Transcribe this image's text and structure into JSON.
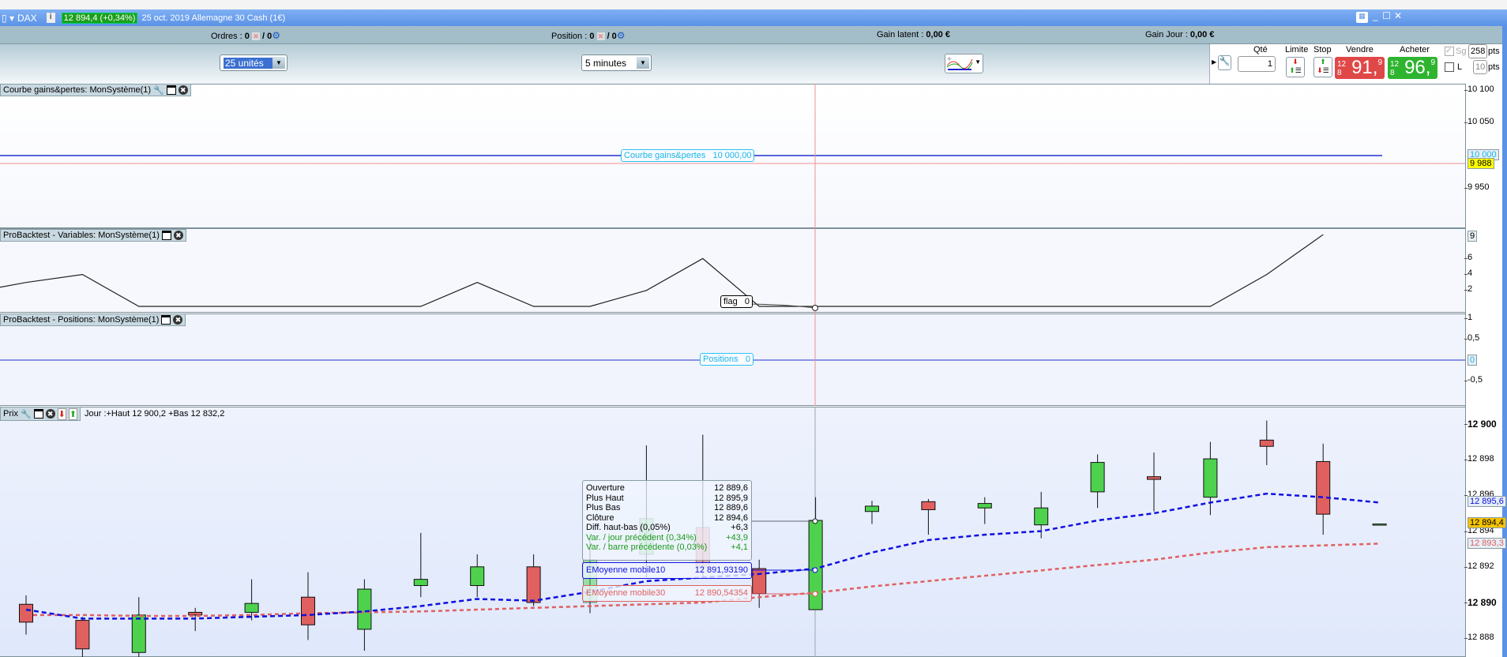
{
  "titlebar": {
    "symbol": "DAX",
    "price_badge": "12 894,4 (+0,34%)",
    "description": "25 oct. 2019 Allemagne 30 Cash (1€)",
    "info_icon": "info-icon",
    "window_icons": [
      "keyboard-icon",
      "minimize-icon",
      "maximize-icon",
      "close-icon"
    ]
  },
  "status": {
    "orders_label": "Ordres :",
    "orders_val": "0",
    "orders_total": "/ 0",
    "position_label": "Position :",
    "position_val": "0",
    "position_total": "/ 0",
    "gain_latent_label": "Gain latent :",
    "gain_latent_val": "0,00 €",
    "gain_jour_label": "Gain Jour :",
    "gain_jour_val": "0,00 €"
  },
  "toolbar": {
    "units": "25 unités",
    "timeframe": "5 minutes"
  },
  "trading": {
    "qty_label": "Qté",
    "qty": "1",
    "limit_label": "Limite",
    "stop_label": "Stop",
    "sell_label": "Vendre",
    "sell_small": "12 8",
    "sell_big": "91,",
    "sell_sup": "9",
    "buy_label": "Acheter",
    "buy_small": "12 8",
    "buy_big": "96,",
    "buy_sup": "9",
    "sg_label": "Sg",
    "sg_pts": "258",
    "l_label": "L",
    "l_pts": "10",
    "pts": "pts",
    "colors": {
      "sell": "#e04848",
      "buy": "#2fb42f"
    }
  },
  "panel_equity": {
    "title": "Courbe gains&pertes: MonSystème(1)",
    "label": "Courbe gains&pertes",
    "value": "10 000,00",
    "ticks": [
      "10 100",
      "10 050",
      "9 950"
    ],
    "current": "10 000",
    "marker": "9 988"
  },
  "panel_vars": {
    "title": "ProBacktest - Variables: MonSystème(1)",
    "label": "flag",
    "value": "0",
    "ticks": [
      "6",
      "4",
      "2"
    ],
    "current": "9",
    "series": [
      2.4,
      3,
      4,
      0,
      0,
      0,
      0,
      0,
      0,
      3,
      0,
      0,
      2,
      6,
      0,
      0,
      0,
      0,
      0,
      0,
      0,
      0,
      0,
      4,
      9
    ]
  },
  "panel_pos": {
    "title": "ProBacktest - Positions: MonSystème(1)",
    "label": "Positions",
    "value": "0",
    "ticks": [
      "1",
      "0,5",
      "-0,5"
    ],
    "current": "0"
  },
  "panel_price": {
    "title": "Prix",
    "day_info": "Jour :+Haut 12 900,2 +Bas 12 832,2",
    "ticks": [
      {
        "v": 12900,
        "t": "12 900",
        "bold": true
      },
      {
        "v": 12898,
        "t": "12 898"
      },
      {
        "v": 12896,
        "t": "12 896"
      },
      {
        "v": 12894,
        "t": "12 894"
      },
      {
        "v": 12892,
        "t": "12 892"
      },
      {
        "v": 12890,
        "t": "12 890",
        "bold": true
      },
      {
        "v": 12888,
        "t": "12 888"
      }
    ],
    "last": "12 894,4",
    "ema10_label": "12 895,6",
    "ema30_label": "12 893,3",
    "candles": [
      [
        12889.9,
        12890.4,
        12888.2,
        12888.9
      ],
      [
        12889.0,
        12889.2,
        12886.9,
        12887.4
      ],
      [
        12887.2,
        12890.3,
        12886.9,
        12889.3
      ],
      [
        12889.45,
        12889.7,
        12888.4,
        12889.3
      ],
      [
        12889.45,
        12891.3,
        12889.0,
        12889.95
      ],
      [
        12890.3,
        12891.7,
        12887.9,
        12888.75
      ],
      [
        12888.5,
        12891.3,
        12887.3,
        12890.75
      ],
      [
        12890.95,
        12893.9,
        12890.3,
        12891.3
      ],
      [
        12890.95,
        12892.7,
        12890.3,
        12892.0
      ],
      [
        12892.0,
        12892.7,
        12889.8,
        12890.0
      ],
      [
        12890.0,
        12893.6,
        12889.4,
        12892.4
      ],
      [
        12892.7,
        12898.8,
        12891.4,
        12894.7
      ],
      [
        12894.2,
        12899.4,
        12891.4,
        12892.0
      ],
      [
        12891.9,
        12892.4,
        12889.7,
        12890.5
      ],
      [
        12889.6,
        12895.9,
        12889.6,
        12894.6
      ],
      [
        12895.1,
        12895.7,
        12894.4,
        12895.4
      ],
      [
        12895.65,
        12895.8,
        12893.8,
        12895.2
      ],
      [
        12895.3,
        12895.9,
        12894.4,
        12895.55
      ],
      [
        12894.35,
        12896.2,
        12893.6,
        12895.3
      ],
      [
        12896.2,
        12898.3,
        12895.3,
        12897.85
      ],
      [
        12897.05,
        12898.4,
        12895.1,
        12896.9
      ],
      [
        12895.9,
        12899.0,
        12894.9,
        12898.05
      ],
      [
        12899.1,
        12900.2,
        12897.7,
        12898.75
      ],
      [
        12897.9,
        12898.9,
        12893.8,
        12894.95
      ],
      [
        12894.4,
        12894.4,
        12894.4,
        12894.4
      ]
    ],
    "ema10": [
      12889.6,
      12889.1,
      12889.1,
      12889.1,
      12889.2,
      12889.3,
      12889.5,
      12889.8,
      12890.2,
      12890.1,
      12890.6,
      12891.2,
      12891.4,
      12891.6,
      12891.9,
      12892.8,
      12893.5,
      12893.8,
      12894.0,
      12894.6,
      12895.0,
      12895.6,
      12896.1,
      12895.9,
      12895.6
    ],
    "ema30": [
      12889.3,
      12889.3,
      12889.25,
      12889.25,
      12889.3,
      12889.4,
      12889.45,
      12889.5,
      12889.6,
      12889.7,
      12889.8,
      12889.9,
      12890.0,
      12890.3,
      12890.55,
      12890.9,
      12891.2,
      12891.5,
      12891.8,
      12892.1,
      12892.4,
      12892.8,
      12893.1,
      12893.2,
      12893.3
    ],
    "tooltip": {
      "rows": [
        [
          "Ouverture",
          "12 889,6"
        ],
        [
          "Plus Haut",
          "12 895,9"
        ],
        [
          "Plus Bas",
          "12 889,6"
        ],
        [
          "Clôture",
          "12 894,6"
        ],
        [
          "Diff. haut-bas (0,05%)",
          "+6,3"
        ]
      ],
      "green_rows": [
        [
          "Var. / jour précédent (0,34%)",
          "+43,9"
        ],
        [
          "Var. / barre précédente (0,03%)",
          "+4,1"
        ]
      ],
      "ema10_name": "EMoyenne mobile10",
      "ema10_val": "12 891,93190",
      "ema30_name": "EMoyenne mobile30",
      "ema30_val": "12 890,54354"
    }
  },
  "colors": {
    "up": "#4ed24e",
    "down": "#e06060",
    "ema10": "#1010e0",
    "ema30": "#e06060"
  }
}
